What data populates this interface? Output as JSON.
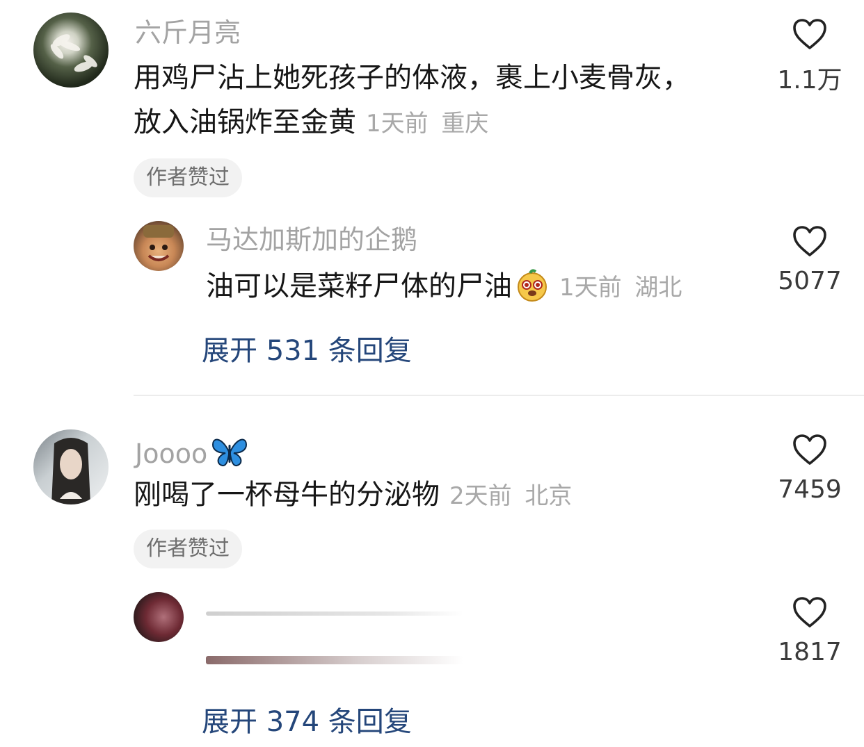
{
  "comments": [
    {
      "username": "六斤月亮",
      "text_line1": "用鸡尸沾上她死孩子的体液，裹上小麦骨灰，",
      "text_line2": "放入油锅炸至金黄",
      "time": "1天前",
      "location": "重庆",
      "likes": "1.1万",
      "author_badge": "作者赞过",
      "reply": {
        "username": "马达加斯加的企鹅",
        "text": "油可以是菜籽尸体的尸油",
        "emoji_icon": "dog-face-emoji-icon",
        "time": "1天前",
        "location": "湖北",
        "likes": "5077"
      },
      "expand_label": "展开 531 条回复"
    },
    {
      "username": "Joooo",
      "username_icon": "butterfly-icon",
      "text": "刚喝了一杯母牛的分泌物",
      "time": "2天前",
      "location": "北京",
      "likes": "7459",
      "author_badge": "作者赞过",
      "reply": {
        "username": "",
        "text": "",
        "likes": "1817"
      },
      "expand_label": "展开 374 条回复"
    }
  ],
  "colors": {
    "username": "#a3a3a3",
    "text": "#161616",
    "meta": "#a8a8a8",
    "link": "#24467a",
    "badge_bg": "#f2f2f2"
  }
}
